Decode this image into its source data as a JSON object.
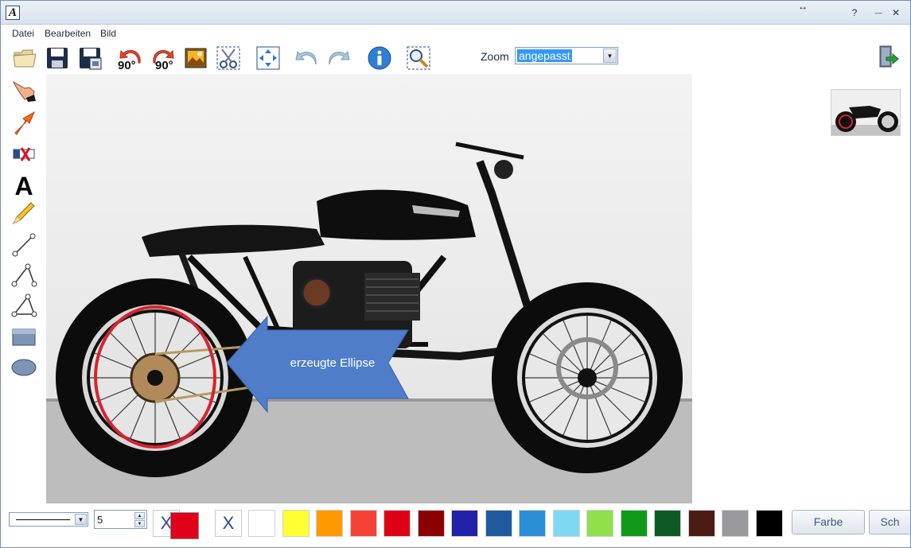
{
  "window": {
    "logo_letter": "A",
    "resize_glyph": "↔",
    "help_label": "?",
    "minimize_label": "—",
    "close_label": "✕"
  },
  "menu": [
    "Datei",
    "Bearbeiten",
    "Bild"
  ],
  "toolbar": {
    "rotate_left_label": "90°",
    "rotate_right_label": "90°",
    "zoom_label": "Zoom",
    "zoom_value": "angepasst",
    "icons": [
      "open-folder-icon",
      "save-icon",
      "save-as-icon",
      "rotate-left-icon",
      "rotate-right-icon",
      "image-icon",
      "crop-scissors-icon",
      "fit-to-window-icon",
      "undo-icon",
      "redo-icon",
      "info-icon",
      "zoom-region-icon",
      "exit-icon"
    ]
  },
  "side_tools": [
    "hand-pointer-icon",
    "arrow-icon",
    "delete-marker-icon",
    "text-icon",
    "pencil-icon",
    "line-icon",
    "polyline-icon",
    "polygon-icon",
    "rectangle-icon",
    "ellipse-icon"
  ],
  "canvas": {
    "annotation_text": "erzeugte Ellipse",
    "ellipse_color": "#d7232f",
    "arrow_color": "#4f7dc9"
  },
  "bottom": {
    "line_width": "5",
    "x_label": "X",
    "selected_color": "#e0001a",
    "swatches": [
      "#ffffff",
      "#ffff33",
      "#ff9900",
      "#f44336",
      "#e00016",
      "#8b0000",
      "#2222a8",
      "#1f5a9e",
      "#2b8fd8",
      "#7fd8f2",
      "#8fe04a",
      "#119a1a",
      "#0e5a24",
      "#4a1c14",
      "#9a9a9e",
      "#000000"
    ],
    "farbe_label": "Farbe",
    "sch_label": "Sch"
  }
}
